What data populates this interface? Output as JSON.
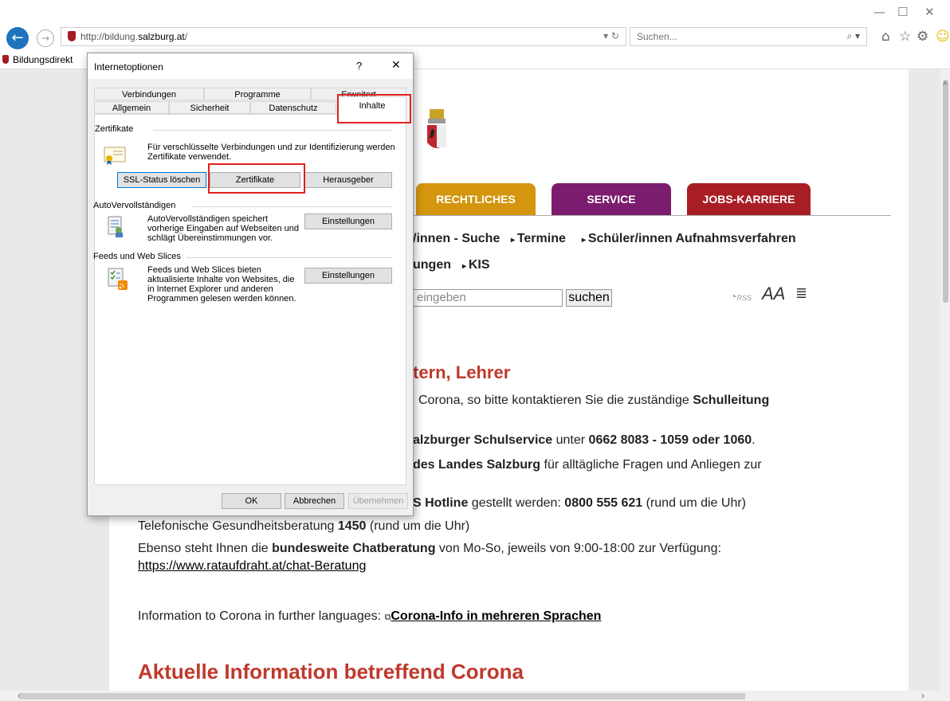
{
  "browser": {
    "url_prefix": "http://bildung.",
    "url_domain": "salzburg.at",
    "url_suffix": "/",
    "addr_controls": "▾ ↻",
    "search_placeholder": "Suchen...",
    "search_controls": "⌕ ▾",
    "tab_title": "Bildungsdirekt",
    "toolbar_icons": [
      "home-icon",
      "favorites-star-icon",
      "settings-gear-icon",
      "smiley-feedback-icon"
    ]
  },
  "site": {
    "nav": [
      {
        "label": "RECHTLICHES",
        "color": "#d4950f"
      },
      {
        "label": "SERVICE",
        "color": "#7b1c6e"
      },
      {
        "label": "JOBS-KARRIERE",
        "color": "#a81e24"
      }
    ],
    "quick_links_row1": [
      "/innen - Suche",
      "Termine",
      "Schüler/innen Aufnahmsverfahren"
    ],
    "quick_links_row2": [
      "ungen",
      "KIS"
    ],
    "search_placeholder": "eingeben",
    "search_button": "suchen",
    "rss_label": "RSS",
    "font_size_label": "AA",
    "heading1": "tern, Lehrer",
    "p1_a": "Corona, so bitte kontaktieren Sie die zuständige ",
    "p1_b": "Schulleitung",
    "p2_a": "alzburger Schulservice",
    "p2_b": " unter ",
    "p2_c": "0662 8083 - 1059 oder 1060",
    "p2_d": ".",
    "p3_a": "des Landes Salzburg",
    "p3_b": " für alltägliche Fragen und Anliegen zur",
    "p4_a": "S Hotline",
    "p4_b": " gestellt werden: ",
    "p4_c": "0800 555 621",
    "p4_d": " (rund um die Uhr)",
    "p5_a": "Telefonische Gesundheitsberatung ",
    "p5_b": "1450",
    "p5_c": " (rund um die Uhr)",
    "p6_a": "Ebenso steht Ihnen die ",
    "p6_b": "bundesweite Chatberatung",
    "p6_c": " von Mo-So, jeweils von 9:00-18:00 zur Verfügung:",
    "p6_link": "https://www.rataufdraht.at/chat-Beratung",
    "p7_a": "Information to Corona in further languages: ",
    "p7_link": "Corona-Info in mehreren Sprachen",
    "heading2": "Aktuelle Information betreffend Corona"
  },
  "dialog": {
    "title": "Internetoptionen",
    "help": "?",
    "close": "✕",
    "tabs_row1": [
      "Verbindungen",
      "Programme",
      "Erweitert"
    ],
    "tabs_row2": [
      "Allgemein",
      "Sicherheit",
      "Datenschutz",
      "Inhalte"
    ],
    "cert_group": "Zertifikate",
    "cert_text": "Für verschlüsselte Verbindungen und zur Identifizierung werden Zertifikate verwendet.",
    "btn_ssl": "SSL-Status löschen",
    "btn_certs": "Zertifikate",
    "btn_publishers": "Herausgeber",
    "auto_group": "AutoVervollständigen",
    "auto_text": "AutoVervollständigen speichert vorherige Eingaben auf Webseiten und schlägt Übereinstimmungen vor.",
    "btn_auto_settings": "Einstellungen",
    "feeds_group": "Feeds und Web Slices",
    "feeds_text": "Feeds und Web Slices bieten aktualisierte Inhalte von Websites, die in Internet Explorer und anderen Programmen gelesen werden können.",
    "btn_feeds_settings": "Einstellungen",
    "btn_ok": "OK",
    "btn_cancel": "Abbrechen",
    "btn_apply": "Übernehmen"
  }
}
